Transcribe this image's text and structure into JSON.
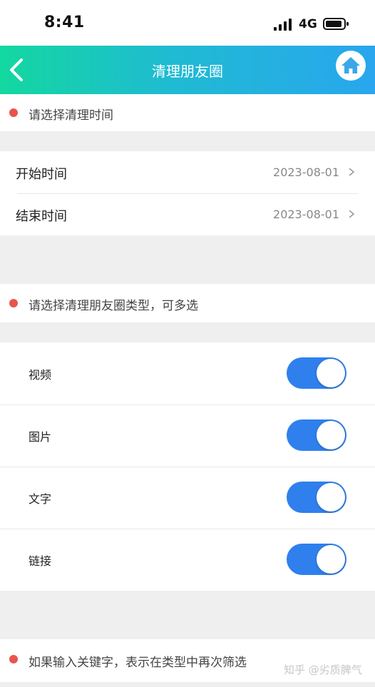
{
  "status_bar": {
    "time": "8:41",
    "network": "4G"
  },
  "nav": {
    "title": "清理朋友圈",
    "back_icon": "chevron-left-icon",
    "home_icon": "home-icon",
    "gradient_colors": [
      "#13d8a0",
      "#29a6ee"
    ]
  },
  "section_time": {
    "label": "请选择清理时间"
  },
  "dates": [
    {
      "label": "开始时间",
      "value": "2023-08-01"
    },
    {
      "label": "结束时间",
      "value": "2023-08-01"
    }
  ],
  "section_type": {
    "label": "请选择清理朋友圈类型，可多选"
  },
  "types": [
    {
      "label": "视频",
      "enabled": true
    },
    {
      "label": "图片",
      "enabled": true
    },
    {
      "label": "文字",
      "enabled": true
    },
    {
      "label": "链接",
      "enabled": true
    }
  ],
  "section_keyword": {
    "label": "如果输入关键字，表示在类型中再次筛选"
  },
  "watermark": "知乎 @劣质脾气",
  "colors": {
    "accent": "#2f80ed",
    "indicator": "#e9544f"
  }
}
